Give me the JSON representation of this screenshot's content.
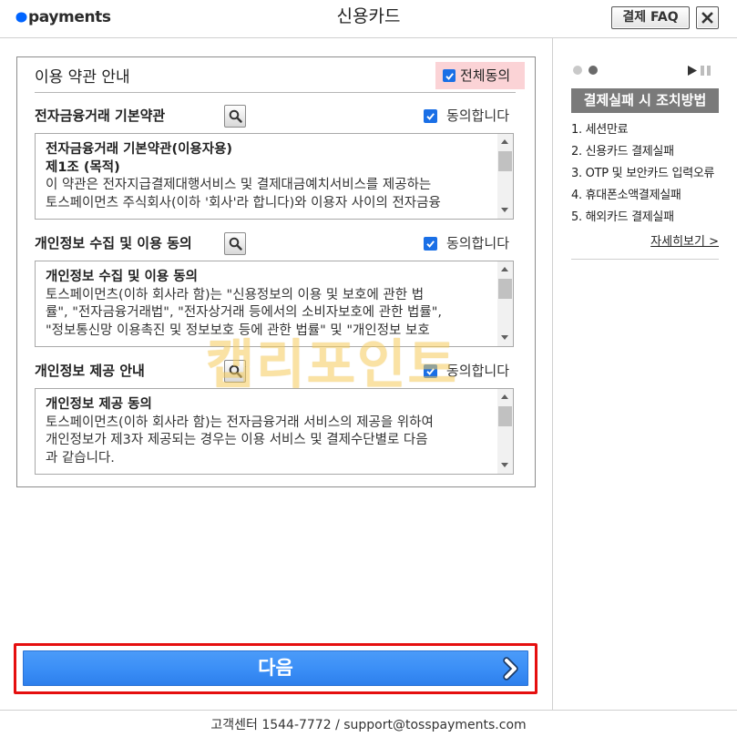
{
  "header": {
    "logo_text": "payments",
    "title": "신용카드",
    "faq_label": "결제 FAQ"
  },
  "terms": {
    "heading": "이용 약관 안내",
    "agree_all": {
      "label": "전체동의",
      "checked": true
    },
    "sections": [
      {
        "title": "전자금융거래 기본약관",
        "agree_label": "동의합니다",
        "checked": true,
        "body": [
          "전자금융거래 기본약관(이용자용)",
          "제1조 (목적)",
          "이 약관은 전자지급결제대행서비스 및 결제대금예치서비스를 제공하는",
          "토스페이먼츠 주식회사(이하 '회사'라 합니다)와 이용자 사이의 전자금융"
        ]
      },
      {
        "title": "개인정보 수집 및 이용 동의",
        "agree_label": "동의합니다",
        "checked": true,
        "body": [
          "개인정보 수집 및 이용 동의",
          "토스페이먼츠(이하 회사라 함)는 \"신용정보의 이용 및 보호에 관한 법",
          "률\", \"전자금융거래법\", \"전자상거래 등에서의 소비자보호에 관한 법률\",",
          "\"정보통신망 이용촉진 및 정보보호 등에 관한 법률\" 및 \"개인정보 보호"
        ]
      },
      {
        "title": "개인정보 제공 안내",
        "agree_label": "동의합니다",
        "checked": true,
        "body": [
          "개인정보 제공 동의",
          "토스페이먼츠(이하 회사라 함)는 전자금융거래 서비스의 제공을 위하여",
          "개인정보가 제3자 제공되는 경우는 이용 서비스 및 결제수단별로 다음",
          "과 같습니다."
        ]
      }
    ]
  },
  "next_button": {
    "label": "다음"
  },
  "help_panel": {
    "carousel": {
      "slide_count": 2,
      "active_slide": 2
    },
    "title": "결제실패 시 조치방법",
    "items": [
      "1. 세션만료",
      "2. 신용카드 결제실패",
      "3. OTP 및 보안카드 입력오류",
      "4. 휴대폰소액결제실패",
      "5. 해외카드 결제실패"
    ],
    "more_link": "자세히보기 >"
  },
  "footer": {
    "text": "고객센터 1544-7772 / support@tosspayments.com"
  },
  "watermark": "캡리포인트",
  "icons": {
    "logo": "toss-logo-icon",
    "close": "close-icon",
    "search": "search-icon",
    "check": "checkmark-icon",
    "next": "chevron-right-icon",
    "play": "play-icon",
    "pause": "pause-icon"
  },
  "colors": {
    "accent": "#3a8ef6",
    "highlight": "#e50f0f",
    "checkbox": "#1a6fe6",
    "agree_all_bg": "#fbd3d6",
    "help_banner": "#7a7a7a",
    "watermark": "#f6cc5a"
  }
}
